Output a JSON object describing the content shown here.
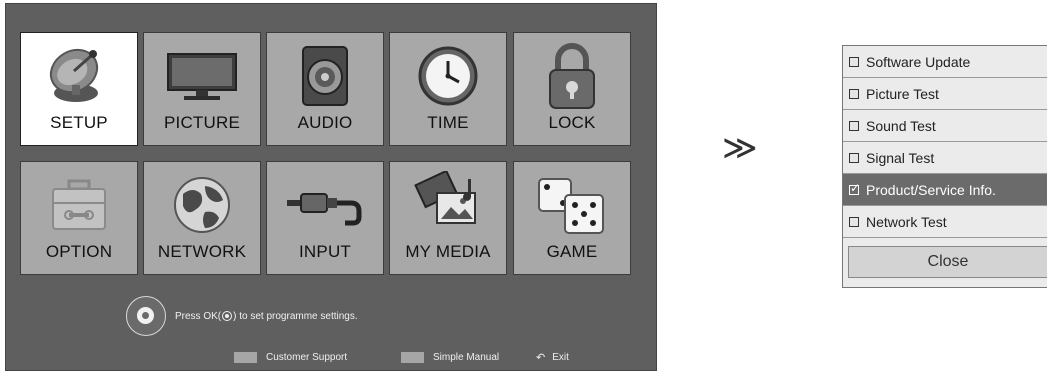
{
  "main_menu": {
    "tiles": [
      {
        "label": "SETUP",
        "icon": "satellite-dish-icon",
        "selected": true
      },
      {
        "label": "PICTURE",
        "icon": "monitor-icon",
        "selected": false
      },
      {
        "label": "AUDIO",
        "icon": "speaker-icon",
        "selected": false
      },
      {
        "label": "TIME",
        "icon": "clock-icon",
        "selected": false
      },
      {
        "label": "LOCK",
        "icon": "padlock-icon",
        "selected": false
      },
      {
        "label": "OPTION",
        "icon": "toolbox-icon",
        "selected": false
      },
      {
        "label": "NETWORK",
        "icon": "globe-icon",
        "selected": false
      },
      {
        "label": "INPUT",
        "icon": "cable-plug-icon",
        "selected": false
      },
      {
        "label": "MY MEDIA",
        "icon": "media-icon",
        "selected": false
      },
      {
        "label": "GAME",
        "icon": "dice-icon",
        "selected": false
      }
    ],
    "hint_before": "Press OK(",
    "hint_after": ") to set programme settings.",
    "legend": {
      "customer_support": "Customer Support",
      "simple_manual": "Simple Manual",
      "exit": "Exit"
    }
  },
  "transition_arrow": "≫",
  "submenu": {
    "items": [
      {
        "label": "Software Update",
        "checked": false
      },
      {
        "label": "Picture Test",
        "checked": false
      },
      {
        "label": "Sound Test",
        "checked": false
      },
      {
        "label": "Signal Test",
        "checked": false
      },
      {
        "label": "Product/Service Info.",
        "checked": true
      },
      {
        "label": "Network Test",
        "checked": false
      }
    ],
    "close_label": "Close"
  },
  "colors": {
    "panel_bg": "#5f5f5f",
    "tile_bg": "#a8a8a8",
    "tile_selected_bg": "#ffffff",
    "menu_selected_bg": "#6b6b6b"
  }
}
